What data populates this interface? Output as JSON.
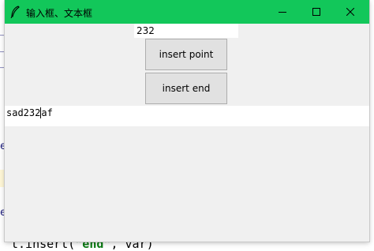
{
  "window": {
    "title": "输入框、文本框",
    "accent_color": "#12c75a",
    "icons": {
      "app": "feather-icon",
      "minimize": "minimize-icon",
      "maximize": "maximize-icon",
      "close": "close-icon"
    }
  },
  "entry": {
    "value": "232"
  },
  "buttons": {
    "insert_point": "insert point",
    "insert_end": "insert end"
  },
  "text_widget": {
    "before_cursor": "sad232",
    "after_cursor": "af"
  },
  "background_code": {
    "line_prefix": "t.insert(",
    "string_literal": "\"end\"",
    "line_suffix": ", var)"
  }
}
